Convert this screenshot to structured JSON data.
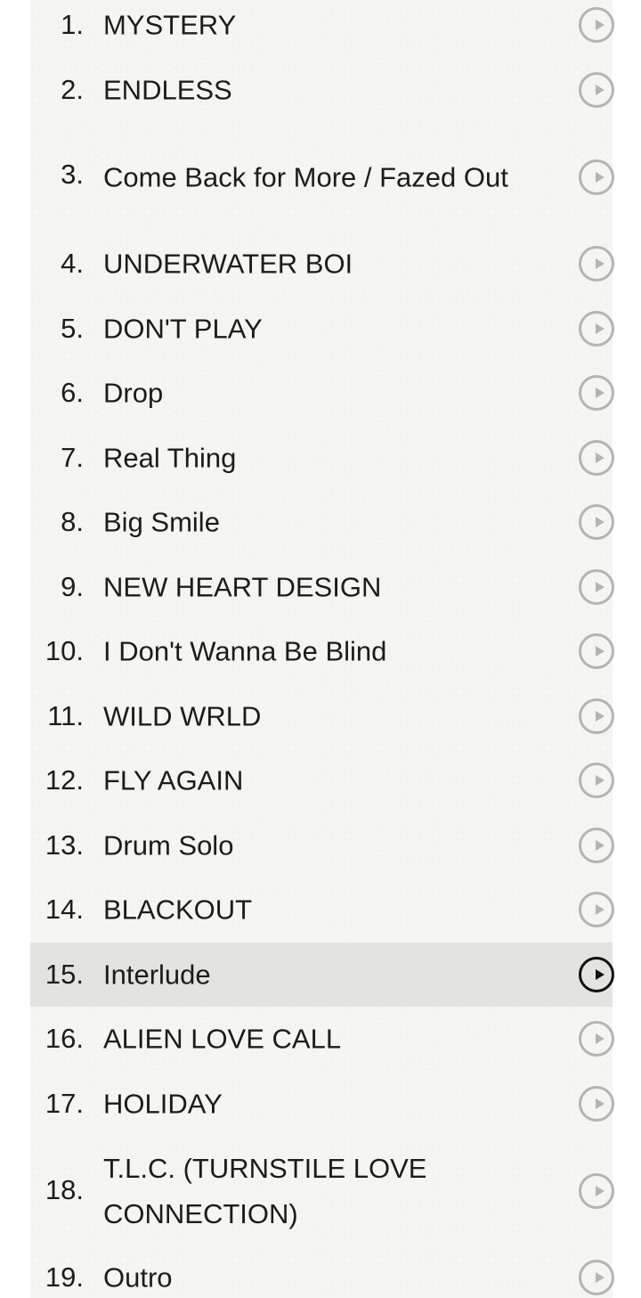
{
  "tracks": [
    {
      "number": "1.",
      "title": "MYSTERY"
    },
    {
      "number": "2.",
      "title": "ENDLESS"
    },
    {
      "number": "3.",
      "title": "Come Back for More / Fazed Out"
    },
    {
      "number": "4.",
      "title": "UNDERWATER BOI"
    },
    {
      "number": "5.",
      "title": "DON'T PLAY"
    },
    {
      "number": "6.",
      "title": "Drop"
    },
    {
      "number": "7.",
      "title": "Real Thing"
    },
    {
      "number": "8.",
      "title": "Big Smile"
    },
    {
      "number": "9.",
      "title": "NEW HEART DESIGN"
    },
    {
      "number": "10.",
      "title": "I Don't Wanna Be Blind"
    },
    {
      "number": "11.",
      "title": "WILD WRLD"
    },
    {
      "number": "12.",
      "title": "FLY AGAIN"
    },
    {
      "number": "13.",
      "title": "Drum Solo"
    },
    {
      "number": "14.",
      "title": "BLACKOUT"
    },
    {
      "number": "15.",
      "title": "Interlude"
    },
    {
      "number": "16.",
      "title": "ALIEN LOVE CALL"
    },
    {
      "number": "17.",
      "title": "HOLIDAY"
    },
    {
      "number": "18.",
      "title": "T.L.C. (TURNSTILE LOVE CONNECTION)"
    },
    {
      "number": "19.",
      "title": "Outro"
    }
  ],
  "active_track_index": 14,
  "icons": {
    "play": "play-circle-icon"
  },
  "colors": {
    "panel_background": "#f5f5f4",
    "active_row_background": "#e3e3e2",
    "text": "#1c1c1c",
    "play_icon_inactive": "#b4b4b4",
    "play_icon_active": "#111111"
  }
}
